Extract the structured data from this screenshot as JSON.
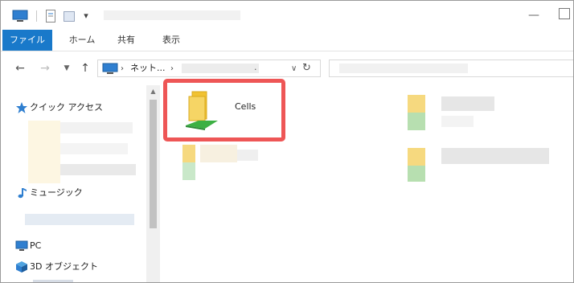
{
  "tabs": [
    {
      "label": "ファイル",
      "active": true
    },
    {
      "label": "ホーム"
    },
    {
      "label": "共有"
    },
    {
      "label": "表示"
    }
  ],
  "address": {
    "crumb": "ネット...",
    "trailing": "."
  },
  "nav_pane": {
    "quick_access": "クイック アクセス",
    "music": "ミュージック",
    "pc": "PC",
    "objects_3d": "3D オブジェクト"
  },
  "files": [
    {
      "name": "Cells",
      "highlighted": true
    }
  ],
  "colors": {
    "file_tab": "#1979ca",
    "highlight": "#ee5656",
    "folder": "#f1c232",
    "network_share": "#3cb043"
  },
  "icons": {
    "back": "arrow-left-icon",
    "forward": "arrow-right-icon",
    "up": "arrow-up-icon",
    "refresh": "refresh-icon",
    "quick_access": "star-icon",
    "music": "music-note-icon",
    "pc": "monitor-icon",
    "objects_3d": "cube-icon",
    "folder": "network-folder-icon"
  }
}
